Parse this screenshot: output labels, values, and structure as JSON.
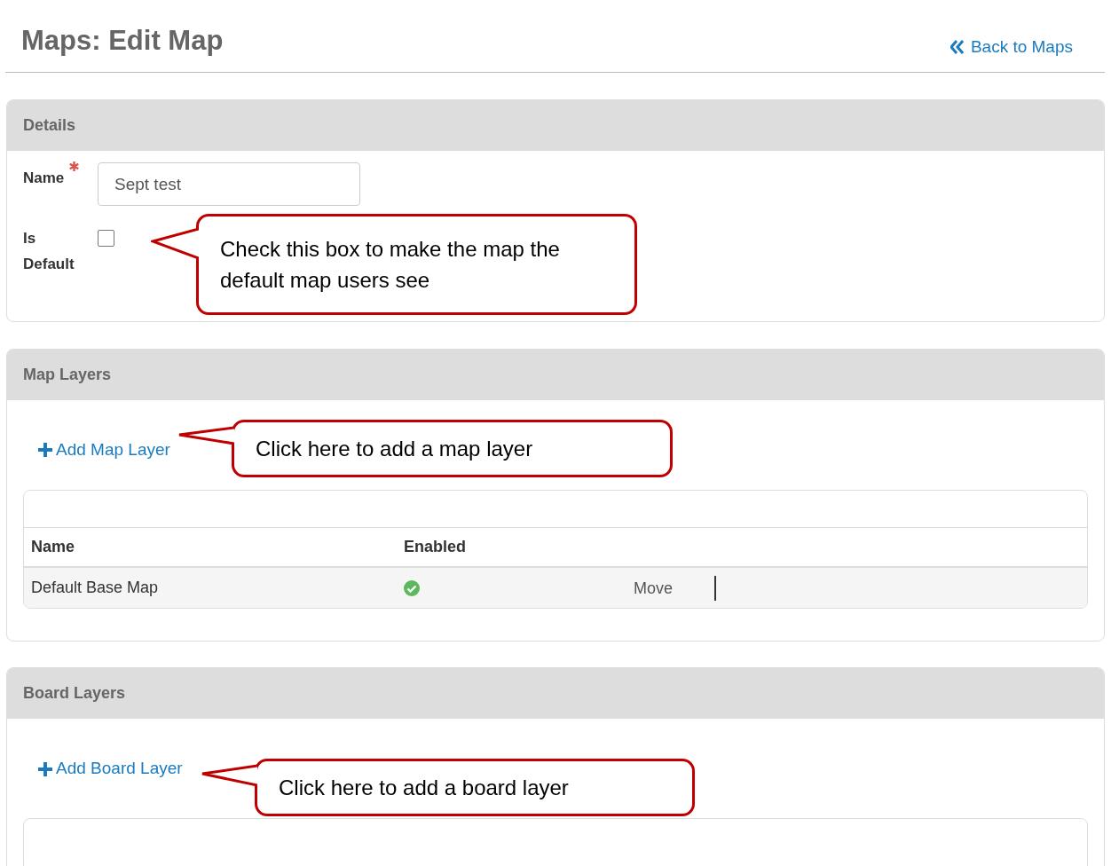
{
  "page": {
    "title": "Maps: Edit Map",
    "back_link": "Back to Maps"
  },
  "details": {
    "heading": "Details",
    "name_label": "Name",
    "required": true,
    "name_value": "Sept test",
    "default_label": "Is Default",
    "is_default": false
  },
  "map_layers": {
    "heading": "Map Layers",
    "add_link": "Add Map Layer",
    "columns": [
      "Name",
      "Enabled"
    ],
    "rows": [
      {
        "name": "Default Base Map",
        "enabled": true,
        "action": "Move"
      }
    ]
  },
  "board_layers": {
    "heading": "Board Layers",
    "add_link": "Add Board Layer"
  },
  "callouts": [
    {
      "text": "Check this box to make the map the default map users see"
    },
    {
      "text": "Click here to add a map layer"
    },
    {
      "text": "Click here to add a board layer"
    }
  ]
}
